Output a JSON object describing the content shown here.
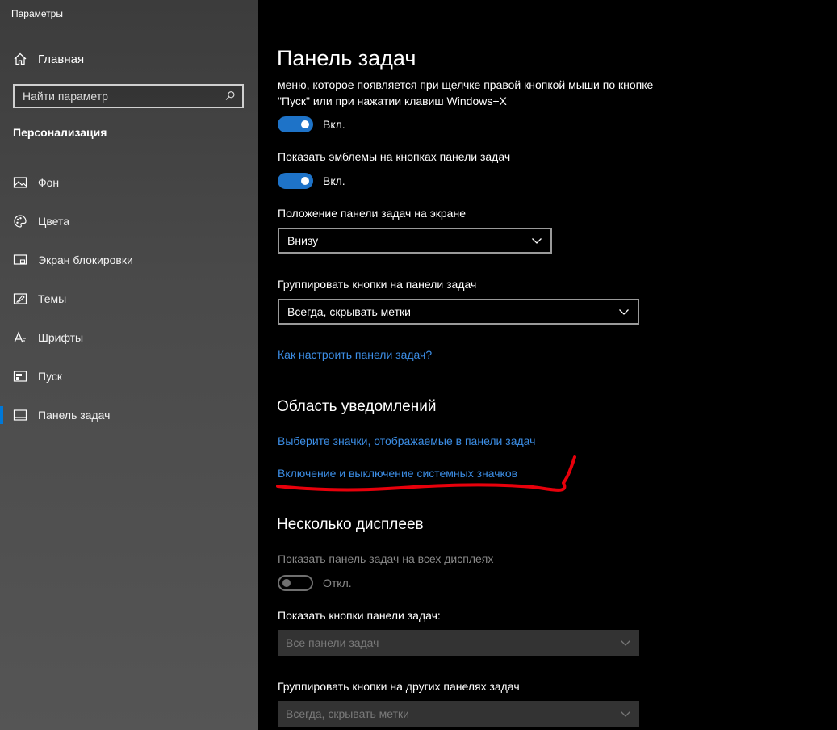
{
  "window": {
    "title": "Параметры"
  },
  "sidebar": {
    "home_label": "Главная",
    "home_icon": "home-icon",
    "search_placeholder": "Найти параметр",
    "search_icon": "search-icon",
    "section_title": "Персонализация",
    "active_item": "Панель задач",
    "items": [
      {
        "label": "Фон",
        "icon": "picture-icon"
      },
      {
        "label": "Цвета",
        "icon": "palette-icon"
      },
      {
        "label": "Экран блокировки",
        "icon": "lock-screen-icon"
      },
      {
        "label": "Темы",
        "icon": "brush-icon"
      },
      {
        "label": "Шрифты",
        "icon": "font-icon"
      },
      {
        "label": "Пуск",
        "icon": "start-icon"
      },
      {
        "label": "Панель задач",
        "icon": "taskbar-icon"
      }
    ]
  },
  "main": {
    "title": "Панель задач",
    "winx_description": "меню, которое появляется при щелчке правой кнопкой мыши по кнопке \"Пуск\" или при нажатии клавиш Windows+X",
    "winx_toggle": {
      "state": "on",
      "text": "Вкл."
    },
    "badges": {
      "label": "Показать эмблемы на кнопках панели задач",
      "toggle_state": "on",
      "toggle_text": "Вкл."
    },
    "position": {
      "label": "Положение панели задач на экране",
      "value": "Внизу"
    },
    "combine": {
      "label": "Группировать кнопки на панели задач",
      "value": "Всегда, скрывать метки"
    },
    "help_link": "Как настроить панели задач?",
    "notification_area": {
      "heading": "Область уведомлений",
      "link_select_icons": "Выберите значки, отображаемые в панели задач",
      "link_system_icons": "Включение и выключение системных значков"
    },
    "multiple_displays": {
      "heading": "Несколько дисплеев",
      "show_all_label": "Показать панель задач на всех дисплеях",
      "show_all_toggle_state": "off",
      "show_all_toggle_text": "Откл.",
      "buttons_label": "Показать кнопки панели задач:",
      "buttons_value": "Все панели задач",
      "combine_other_label": "Группировать кнопки на других панелях задач",
      "combine_other_value": "Всегда, скрывать метки"
    }
  },
  "colors": {
    "accent": "#0078d7",
    "link": "#3c8ee6",
    "annotation": "#e8000b"
  }
}
